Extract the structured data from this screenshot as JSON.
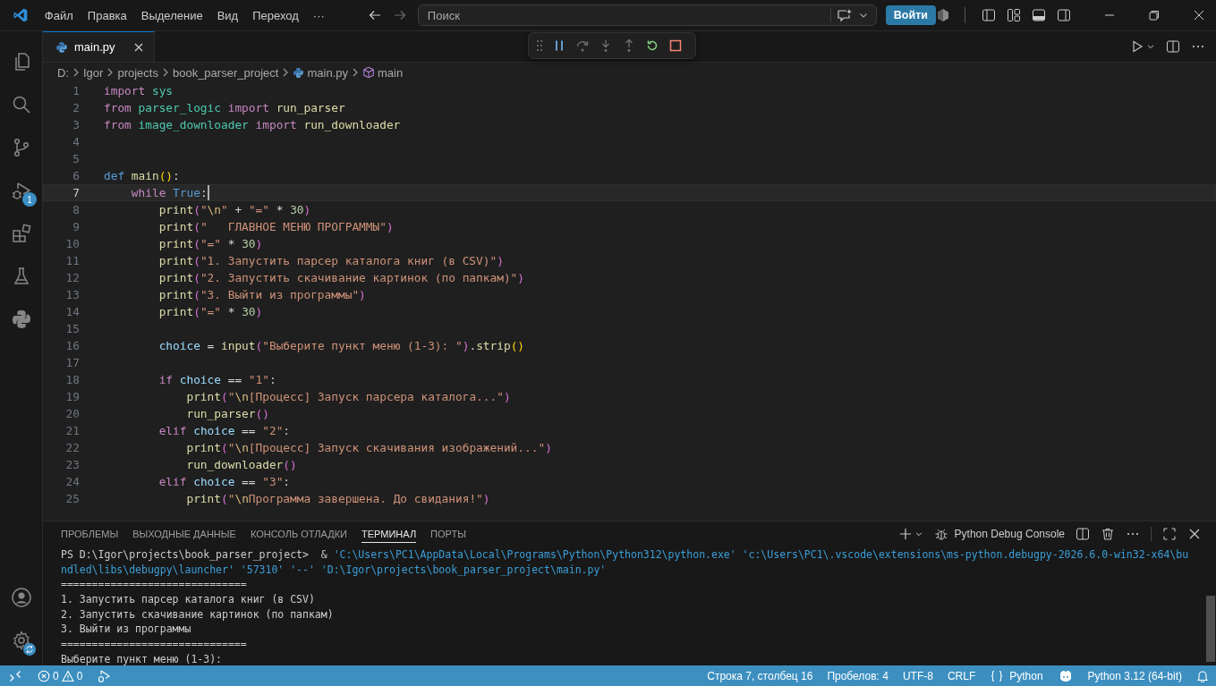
{
  "menu": [
    "Файл",
    "Правка",
    "Выделение",
    "Вид",
    "Переход",
    "···"
  ],
  "search": {
    "placeholder": "Поиск"
  },
  "sign_in_button": "Войти",
  "activity_bar": {
    "items": [
      {
        "kind": "explorer"
      },
      {
        "kind": "search"
      },
      {
        "kind": "source-control"
      },
      {
        "kind": "debug",
        "badge": "1"
      },
      {
        "kind": "extensions"
      },
      {
        "kind": "testing"
      },
      {
        "kind": "python"
      }
    ]
  },
  "tabs": [
    {
      "label": "main.py",
      "selected": true
    }
  ],
  "breadcrumbs": [
    {
      "label": "D:",
      "kind": "folder"
    },
    {
      "label": "Igor",
      "kind": "folder"
    },
    {
      "label": "projects",
      "kind": "folder"
    },
    {
      "label": "book_parser_project",
      "kind": "folder"
    },
    {
      "label": "main.py",
      "kind": "file"
    },
    {
      "label": "main",
      "kind": "symbol"
    }
  ],
  "code_lines": [
    {
      "number": "1",
      "current": false,
      "tokens": [
        {
          "text": "import ",
          "kind": "kw"
        },
        {
          "text": "sys",
          "kind": "mod"
        }
      ]
    },
    {
      "number": "2",
      "current": false,
      "tokens": [
        {
          "text": "from ",
          "kind": "kw"
        },
        {
          "text": "parser_logic ",
          "kind": "mod"
        },
        {
          "text": "import ",
          "kind": "kw"
        },
        {
          "text": "run_parser",
          "kind": "fn"
        }
      ]
    },
    {
      "number": "3",
      "current": false,
      "tokens": [
        {
          "text": "from ",
          "kind": "kw"
        },
        {
          "text": "image_downloader ",
          "kind": "mod"
        },
        {
          "text": "import ",
          "kind": "kw"
        },
        {
          "text": "run_downloader",
          "kind": "fn"
        }
      ]
    },
    {
      "number": "4",
      "current": false
    },
    {
      "number": "5",
      "current": false
    },
    {
      "number": "6",
      "current": false,
      "tokens": [
        {
          "text": "def ",
          "kind": "def"
        },
        {
          "text": "main",
          "kind": "fn"
        },
        {
          "text": "()",
          "kind": "b1"
        },
        {
          "text": ":",
          "kind": "op"
        }
      ]
    },
    {
      "number": "7",
      "current": true,
      "tokens": [
        {
          "text": "    while ",
          "kind": "kw"
        },
        {
          "text": "True",
          "kind": "def"
        },
        {
          "text": ":",
          "kind": "op"
        }
      ]
    },
    {
      "number": "8",
      "current": false,
      "tokens": [
        {
          "text": "        print",
          "kind": "fn"
        },
        {
          "text": "(",
          "kind": "b2"
        },
        {
          "text": "\"",
          "kind": "str"
        },
        {
          "text": "\\n",
          "kind": "esc"
        },
        {
          "text": "\"",
          "kind": "str"
        },
        {
          "text": " + ",
          "kind": "op"
        },
        {
          "text": "\"=\"",
          "kind": "str"
        },
        {
          "text": " * ",
          "kind": "op"
        },
        {
          "text": "30",
          "kind": "num"
        },
        {
          "text": ")",
          "kind": "b2"
        }
      ]
    },
    {
      "number": "9",
      "current": false,
      "tokens": [
        {
          "text": "        print",
          "kind": "fn"
        },
        {
          "text": "(",
          "kind": "b2"
        },
        {
          "text": "\"   ГЛАВНОЕ МЕНЮ ПРОГРАММЫ\"",
          "kind": "str"
        },
        {
          "text": ")",
          "kind": "b2"
        }
      ]
    },
    {
      "number": "10",
      "current": false,
      "tokens": [
        {
          "text": "        print",
          "kind": "fn"
        },
        {
          "text": "(",
          "kind": "b2"
        },
        {
          "text": "\"=\"",
          "kind": "str"
        },
        {
          "text": " * ",
          "kind": "op"
        },
        {
          "text": "30",
          "kind": "num"
        },
        {
          "text": ")",
          "kind": "b2"
        }
      ]
    },
    {
      "number": "11",
      "current": false,
      "tokens": [
        {
          "text": "        print",
          "kind": "fn"
        },
        {
          "text": "(",
          "kind": "b2"
        },
        {
          "text": "\"1. Запустить парсер каталога книг (в CSV)\"",
          "kind": "str"
        },
        {
          "text": ")",
          "kind": "b2"
        }
      ]
    },
    {
      "number": "12",
      "current": false,
      "tokens": [
        {
          "text": "        print",
          "kind": "fn"
        },
        {
          "text": "(",
          "kind": "b2"
        },
        {
          "text": "\"2. Запустить скачивание картинок (по папкам)\"",
          "kind": "str"
        },
        {
          "text": ")",
          "kind": "b2"
        }
      ]
    },
    {
      "number": "13",
      "current": false,
      "tokens": [
        {
          "text": "        print",
          "kind": "fn"
        },
        {
          "text": "(",
          "kind": "b2"
        },
        {
          "text": "\"3. Выйти из программы\"",
          "kind": "str"
        },
        {
          "text": ")",
          "kind": "b2"
        }
      ]
    },
    {
      "number": "14",
      "current": false,
      "tokens": [
        {
          "text": "        print",
          "kind": "fn"
        },
        {
          "text": "(",
          "kind": "b2"
        },
        {
          "text": "\"=\"",
          "kind": "str"
        },
        {
          "text": " * ",
          "kind": "op"
        },
        {
          "text": "30",
          "kind": "num"
        },
        {
          "text": ")",
          "kind": "b2"
        }
      ]
    },
    {
      "number": "15",
      "current": false
    },
    {
      "number": "16",
      "current": false,
      "tokens": [
        {
          "text": "        choice",
          "kind": "var"
        },
        {
          "text": " = ",
          "kind": "op"
        },
        {
          "text": "input",
          "kind": "fn"
        },
        {
          "text": "(",
          "kind": "b2"
        },
        {
          "text": "\"Выберите пункт меню (1-3): \"",
          "kind": "str"
        },
        {
          "text": ")",
          "kind": "b2"
        },
        {
          "text": ".",
          "kind": "op"
        },
        {
          "text": "strip",
          "kind": "fn"
        },
        {
          "text": "()",
          "kind": "b1"
        }
      ]
    },
    {
      "number": "17",
      "current": false
    },
    {
      "number": "18",
      "current": false,
      "tokens": [
        {
          "text": "        if ",
          "kind": "kw"
        },
        {
          "text": "choice",
          "kind": "var"
        },
        {
          "text": " == ",
          "kind": "op"
        },
        {
          "text": "\"1\"",
          "kind": "str"
        },
        {
          "text": ":",
          "kind": "op"
        }
      ]
    },
    {
      "number": "19",
      "current": false,
      "tokens": [
        {
          "text": "            print",
          "kind": "fn"
        },
        {
          "text": "(",
          "kind": "b2"
        },
        {
          "text": "\"",
          "kind": "str"
        },
        {
          "text": "\\n",
          "kind": "esc"
        },
        {
          "text": "[Процесс] Запуск парсера каталога...\"",
          "kind": "str"
        },
        {
          "text": ")",
          "kind": "b2"
        }
      ]
    },
    {
      "number": "20",
      "current": false,
      "tokens": [
        {
          "text": "            run_parser",
          "kind": "fn"
        },
        {
          "text": "()",
          "kind": "b2"
        }
      ]
    },
    {
      "number": "21",
      "current": false,
      "tokens": [
        {
          "text": "        elif ",
          "kind": "kw"
        },
        {
          "text": "choice",
          "kind": "var"
        },
        {
          "text": " == ",
          "kind": "op"
        },
        {
          "text": "\"2\"",
          "kind": "str"
        },
        {
          "text": ":",
          "kind": "op"
        }
      ]
    },
    {
      "number": "22",
      "current": false,
      "tokens": [
        {
          "text": "            print",
          "kind": "fn"
        },
        {
          "text": "(",
          "kind": "b2"
        },
        {
          "text": "\"",
          "kind": "str"
        },
        {
          "text": "\\n",
          "kind": "esc"
        },
        {
          "text": "[Процесс] Запуск скачивания изображений...\"",
          "kind": "str"
        },
        {
          "text": ")",
          "kind": "b2"
        }
      ]
    },
    {
      "number": "23",
      "current": false,
      "tokens": [
        {
          "text": "            run_downloader",
          "kind": "fn"
        },
        {
          "text": "()",
          "kind": "b2"
        }
      ]
    },
    {
      "number": "24",
      "current": false,
      "tokens": [
        {
          "text": "        elif ",
          "kind": "kw"
        },
        {
          "text": "choice",
          "kind": "var"
        },
        {
          "text": " == ",
          "kind": "op"
        },
        {
          "text": "\"3\"",
          "kind": "str"
        },
        {
          "text": ":",
          "kind": "op"
        }
      ]
    },
    {
      "number": "25",
      "current": false,
      "tokens": [
        {
          "text": "            print",
          "kind": "fn"
        },
        {
          "text": "(",
          "kind": "b2"
        },
        {
          "text": "\"",
          "kind": "str"
        },
        {
          "text": "\\n",
          "kind": "esc"
        },
        {
          "text": "Программа завершена. До свидания!\"",
          "kind": "str"
        },
        {
          "text": ")",
          "kind": "b2"
        }
      ]
    }
  ],
  "panel": {
    "tabs": [
      {
        "label": "ПРОБЛЕМЫ",
        "selected": false
      },
      {
        "label": "ВЫХОДНЫЕ ДАННЫЕ",
        "selected": false
      },
      {
        "label": "КОНСОЛЬ ОТЛАДКИ",
        "selected": false
      },
      {
        "label": "ТЕРМИНАЛ",
        "selected": true
      },
      {
        "label": "ПОРТЫ",
        "selected": false
      }
    ],
    "terminal_name": "Python Debug Console",
    "terminal_lines": [
      {
        "segments": [
          {
            "text": "PS D:\\Igor\\projects\\book_parser_project>  & ",
            "kind": "plain"
          },
          {
            "text": "'C:\\Users\\PC1\\AppData\\Local\\Programs\\Python\\Python312\\python.exe' 'c:\\Users\\PC1\\.vscode\\extensions\\ms-python.debugpy-2026.6.0-win32-x64\\bu",
            "kind": "path"
          }
        ]
      },
      {
        "segments": [
          {
            "text": "ndled\\libs\\debugpy\\launcher' '57310' '--' 'D:\\Igor\\projects\\book_parser_project\\main.py'",
            "kind": "path"
          }
        ]
      },
      {
        "segments": [
          {
            "text": "==============================",
            "kind": "plain"
          }
        ]
      },
      {
        "segments": [
          {
            "text": "1. Запустить парсер каталога книг (в CSV)",
            "kind": "plain"
          }
        ]
      },
      {
        "segments": [
          {
            "text": "2. Запустить скачивание картинок (по папкам)",
            "kind": "plain"
          }
        ]
      },
      {
        "segments": [
          {
            "text": "3. Выйти из программы",
            "kind": "plain"
          }
        ]
      },
      {
        "segments": [
          {
            "text": "==============================",
            "kind": "plain"
          }
        ]
      },
      {
        "segments": [
          {
            "text": "Выберите пункт меню (1-3):",
            "kind": "plain"
          }
        ]
      }
    ]
  },
  "status_bar": {
    "errors": "0",
    "warnings": "0",
    "items": [
      {
        "text": "Строка 7, столбец 16",
        "kind": "text"
      },
      {
        "text": "Пробелов: 4",
        "kind": "text"
      },
      {
        "text": "UTF-8",
        "kind": "text"
      },
      {
        "text": "CRLF",
        "kind": "text"
      },
      {
        "text": "Python",
        "kind": "language"
      },
      {
        "kind": "copilot"
      },
      {
        "text": "Python 3.12 (64-bit)",
        "kind": "text"
      },
      {
        "kind": "bell"
      }
    ]
  }
}
